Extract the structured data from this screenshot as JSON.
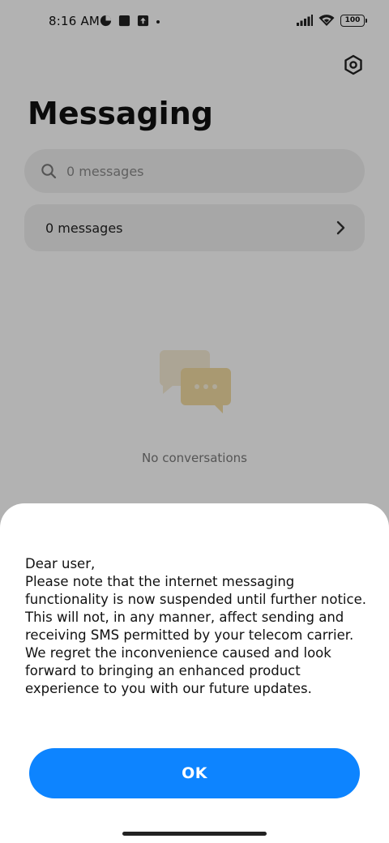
{
  "status_bar": {
    "time": "8:16 AM",
    "battery": "100"
  },
  "app": {
    "title": "Messaging",
    "search": {
      "placeholder": "0 messages"
    },
    "messages_row": {
      "label": "0 messages"
    },
    "empty_state": {
      "text": "No conversations"
    }
  },
  "dialog": {
    "message": "Dear user,\nPlease note that the internet messaging functionality is now suspended until further notice. This will not, in any manner, affect sending and receiving SMS permitted by your telecom carrier. We regret the inconvenience caused and look forward to bringing an enhanced product experience to you with our future updates.",
    "ok_label": "OK"
  },
  "colors": {
    "accent": "#0d84ff",
    "empty_bubble_back": "#f6e7c9",
    "empty_bubble_front": "#f1d89a"
  },
  "icons": {
    "settings": "hexagon-gear-icon",
    "search": "search-icon",
    "chevron": "chevron-right-icon",
    "empty": "chat-bubbles-icon"
  }
}
